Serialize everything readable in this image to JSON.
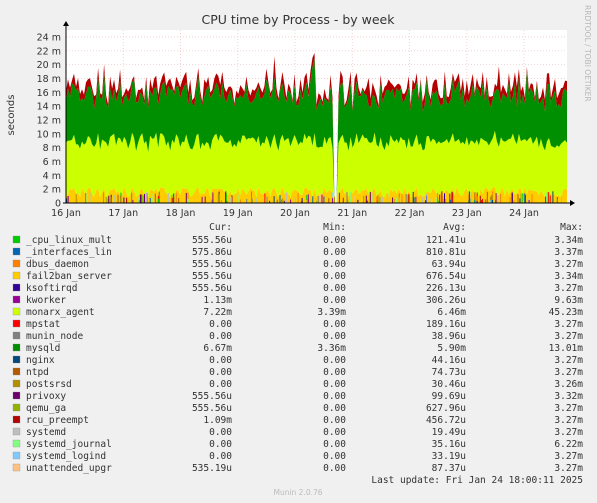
{
  "side_credit": "RRDTOOL / TOBI OETIKER",
  "footer": "Munin 2.0.76",
  "chart_data": {
    "type": "area",
    "title": "CPU time by Process - by week",
    "ylabel": "seconds",
    "ylim": [
      0,
      25
    ],
    "yticks": [
      0,
      2,
      4,
      6,
      8,
      10,
      12,
      14,
      16,
      18,
      20,
      22,
      24
    ],
    "yticklabels": [
      "0",
      "2 m",
      "4 m",
      "6 m",
      "8 m",
      "10 m",
      "12 m",
      "14 m",
      "16 m",
      "18 m",
      "20 m",
      "22 m",
      "24 m"
    ],
    "yunit": "m",
    "xlim": [
      "2025-01-16",
      "2025-01-24 18:00"
    ],
    "xticks": [
      "16 Jan",
      "17 Jan",
      "18 Jan",
      "19 Jan",
      "20 Jan",
      "21 Jan",
      "22 Jan",
      "23 Jan",
      "24 Jan"
    ],
    "grid": true,
    "approx_stack_bands_m": [
      {
        "name": "lower processes",
        "from": 0,
        "to": 1.3
      },
      {
        "name": "monarx_agent",
        "from": 1.3,
        "to": 8.8
      },
      {
        "name": "mysqld",
        "from": 8.8,
        "to": 15.5
      },
      {
        "name": "rcu_preempt / other",
        "from": 15.5,
        "to": 16.5
      }
    ],
    "columns": [
      "",
      "Cur:",
      "Min:",
      "Avg:",
      "Max:"
    ],
    "series": [
      {
        "name": "_cpu_linux_mult",
        "color": "#00cc00",
        "cur": "555.56u",
        "min": "0.00",
        "avg": "121.41u",
        "max": "3.34m"
      },
      {
        "name": "_interfaces_lin",
        "color": "#0066b3",
        "cur": "575.86u",
        "min": "0.00",
        "avg": "810.81u",
        "max": "3.37m"
      },
      {
        "name": "dbus_daemon",
        "color": "#ff8000",
        "cur": "555.56u",
        "min": "0.00",
        "avg": "63.94u",
        "max": "3.27m"
      },
      {
        "name": "fail2ban_server",
        "color": "#ffcc00",
        "cur": "555.56u",
        "min": "0.00",
        "avg": "676.54u",
        "max": "3.34m"
      },
      {
        "name": "ksoftirqd",
        "color": "#330099",
        "cur": "555.56u",
        "min": "0.00",
        "avg": "226.13u",
        "max": "3.27m"
      },
      {
        "name": "kworker",
        "color": "#990099",
        "cur": "1.13m",
        "min": "0.00",
        "avg": "306.26u",
        "max": "9.63m"
      },
      {
        "name": "monarx_agent",
        "color": "#ccff00",
        "cur": "7.22m",
        "min": "3.39m",
        "avg": "6.46m",
        "max": "45.23m"
      },
      {
        "name": "mpstat",
        "color": "#ff0000",
        "cur": "0.00",
        "min": "0.00",
        "avg": "189.16u",
        "max": "3.27m"
      },
      {
        "name": "munin_node",
        "color": "#808080",
        "cur": "0.00",
        "min": "0.00",
        "avg": "38.96u",
        "max": "3.27m"
      },
      {
        "name": "mysqld",
        "color": "#008f00",
        "cur": "6.67m",
        "min": "3.36m",
        "avg": "5.90m",
        "max": "13.01m"
      },
      {
        "name": "nginx",
        "color": "#00487d",
        "cur": "0.00",
        "min": "0.00",
        "avg": "44.16u",
        "max": "3.27m"
      },
      {
        "name": "ntpd",
        "color": "#b35a00",
        "cur": "0.00",
        "min": "0.00",
        "avg": "74.73u",
        "max": "3.27m"
      },
      {
        "name": "postsrsd",
        "color": "#b38f00",
        "cur": "0.00",
        "min": "0.00",
        "avg": "30.46u",
        "max": "3.26m"
      },
      {
        "name": "privoxy",
        "color": "#6b006b",
        "cur": "555.56u",
        "min": "0.00",
        "avg": "99.69u",
        "max": "3.32m"
      },
      {
        "name": "qemu_ga",
        "color": "#8fb300",
        "cur": "555.56u",
        "min": "0.00",
        "avg": "627.96u",
        "max": "3.27m"
      },
      {
        "name": "rcu_preempt",
        "color": "#b30000",
        "cur": "1.09m",
        "min": "0.00",
        "avg": "456.72u",
        "max": "3.27m"
      },
      {
        "name": "systemd",
        "color": "#bebebe",
        "cur": "0.00",
        "min": "0.00",
        "avg": "19.49u",
        "max": "3.27m"
      },
      {
        "name": "systemd_journal",
        "color": "#80ff80",
        "cur": "0.00",
        "min": "0.00",
        "avg": "35.16u",
        "max": "6.22m"
      },
      {
        "name": "systemd_logind",
        "color": "#80c9ff",
        "cur": "0.00",
        "min": "0.00",
        "avg": "33.19u",
        "max": "3.27m"
      },
      {
        "name": "unattended_upgr",
        "color": "#ffc080",
        "cur": "535.19u",
        "min": "0.00",
        "avg": "87.37u",
        "max": "3.27m"
      }
    ],
    "last_update": "Last update: Fri Jan 24 18:00:11 2025"
  }
}
